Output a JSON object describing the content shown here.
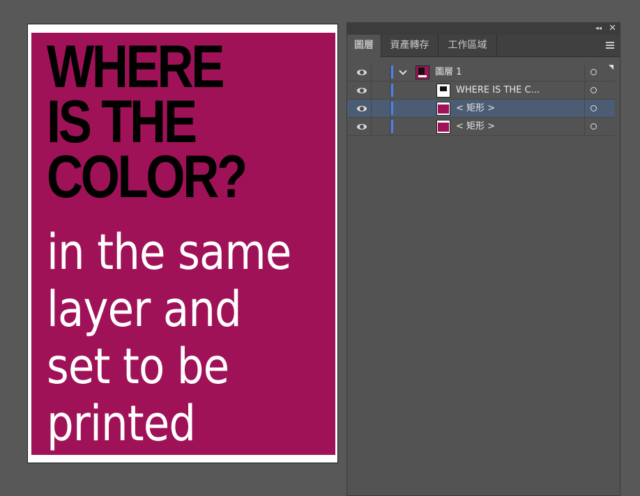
{
  "colors": {
    "poster_background": "#a01258",
    "headline_color": "#000000",
    "body_color": "#ffffff",
    "selection_highlight": "#4c5d73",
    "layer_color_bar": "#4f7df5"
  },
  "artboard": {
    "headline_lines": [
      "WHERE",
      "IS THE",
      "COLOR?"
    ],
    "body_lines": [
      "in the same",
      "layer and",
      "set to be",
      "printed"
    ]
  },
  "panel": {
    "collapse_glyph": "◂◂",
    "close_glyph": "✕",
    "tabs": [
      {
        "label": "圖層",
        "active": true
      },
      {
        "label": "資產轉存",
        "active": false
      },
      {
        "label": "工作區域",
        "active": false
      }
    ],
    "menu_icon": "hamburger-menu-icon",
    "layers": [
      {
        "name": "圖層 1",
        "kind": "layer",
        "expanded": true,
        "selected": false,
        "visible": true
      },
      {
        "name": "WHERE  IS THE  C...",
        "kind": "text",
        "selected": false,
        "visible": true
      },
      {
        "name": "< 矩形 >",
        "kind": "rectangle",
        "selected": true,
        "visible": true
      },
      {
        "name": "< 矩形 >",
        "kind": "rectangle",
        "selected": false,
        "visible": true
      }
    ]
  }
}
